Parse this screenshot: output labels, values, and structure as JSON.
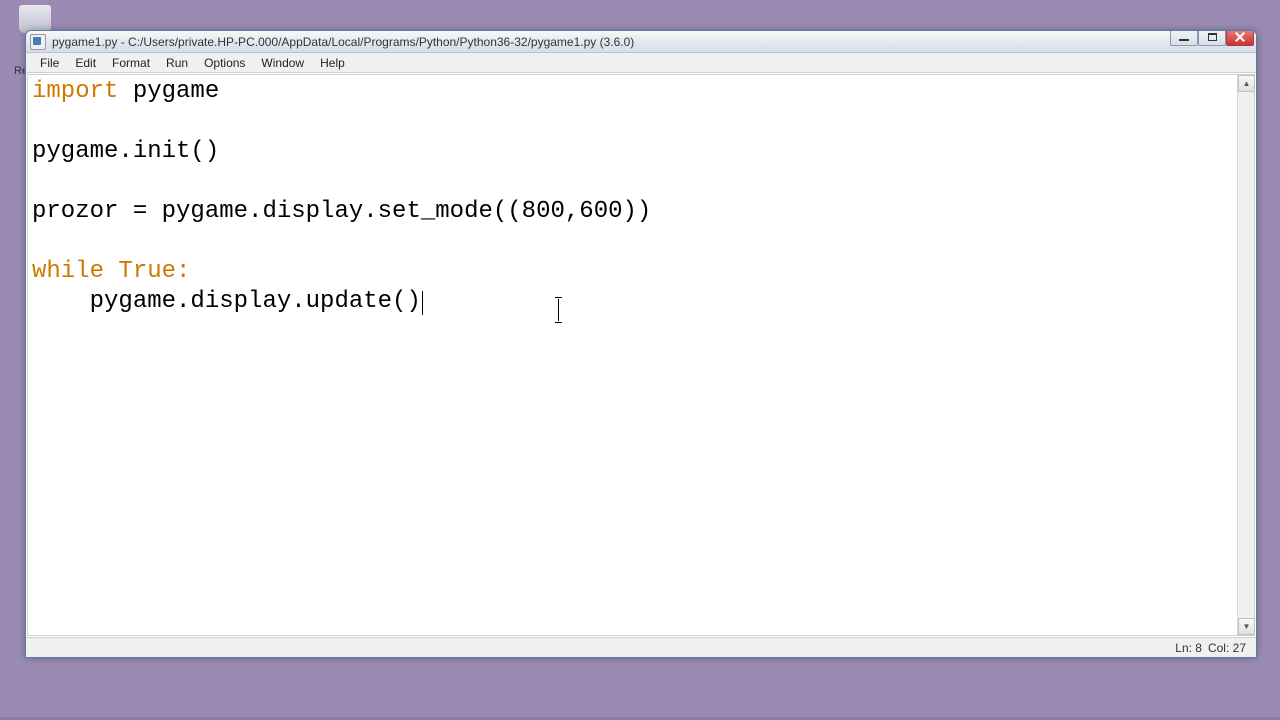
{
  "desktop": {
    "recycle_label_partial": "Re"
  },
  "window": {
    "title": "pygame1.py - C:/Users/private.HP-PC.000/AppData/Local/Programs/Python/Python36-32/pygame1.py (3.6.0)"
  },
  "menu": {
    "items": [
      "File",
      "Edit",
      "Format",
      "Run",
      "Options",
      "Window",
      "Help"
    ]
  },
  "code": {
    "kw_import": "import",
    "module": " pygame",
    "blank1": "",
    "line_init": "pygame.init()",
    "blank2": "",
    "line_mode": "prozor = pygame.display.set_mode((800,600))",
    "blank3": "",
    "kw_while": "while",
    "true_colon": " True:",
    "line_update": "    pygame.display.update()"
  },
  "status": {
    "line": "Ln: 8",
    "col": "Col: 27"
  }
}
